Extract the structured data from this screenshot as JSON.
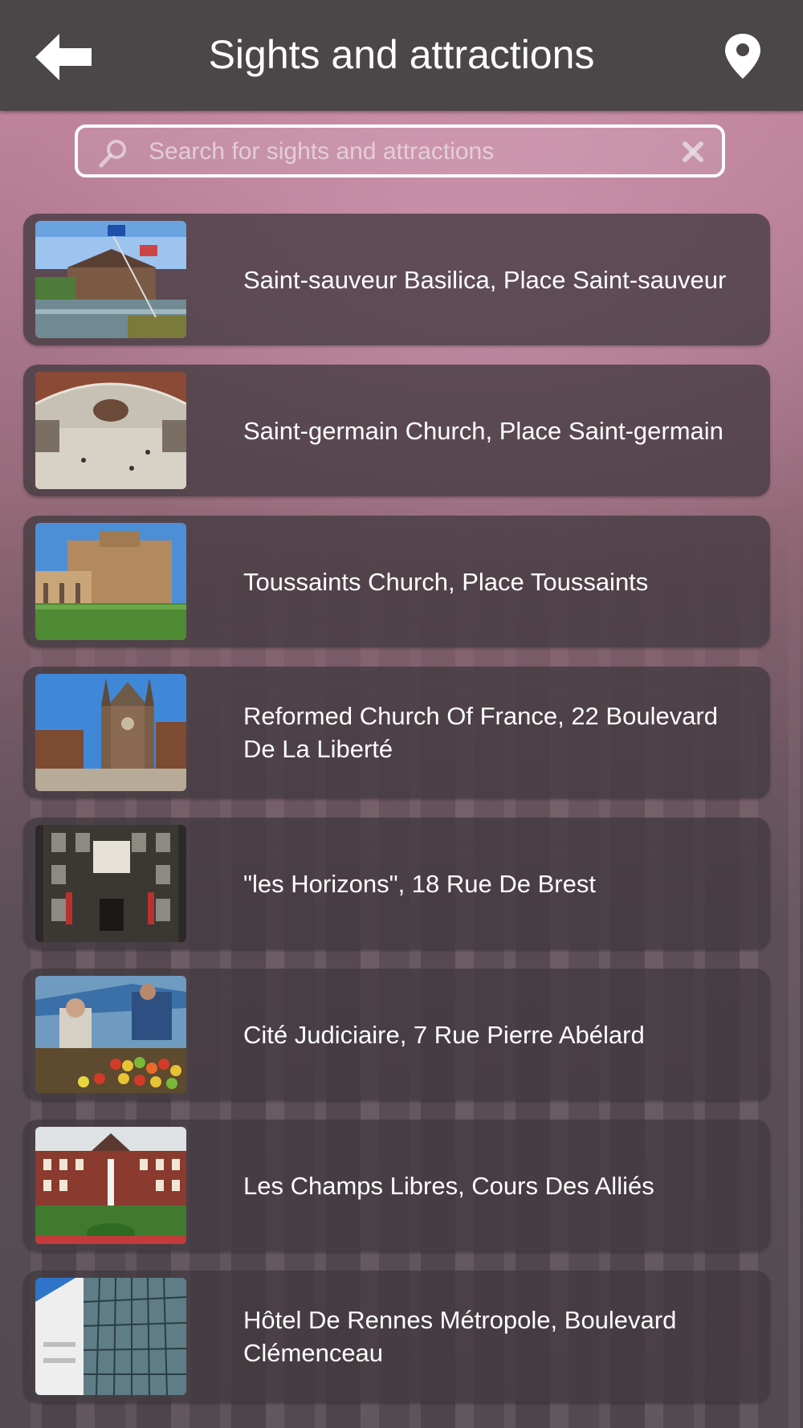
{
  "header": {
    "title": "Sights and attractions",
    "back_icon": "arrow-left-icon",
    "map_icon": "map-pin-icon",
    "bar_color": "#4b4748"
  },
  "search": {
    "placeholder": "Search for sights and attractions",
    "value": "",
    "search_icon": "magnifier-icon",
    "clear_icon": "close-icon"
  },
  "list": {
    "items": [
      {
        "label": "Saint-sauveur Basilica, Place Saint-sauveur",
        "thumbnail": "parliament-pond-flags"
      },
      {
        "label": "Saint-germain Church, Place Saint-germain",
        "thumbnail": "panorama-dome-hall"
      },
      {
        "label": "Toussaints Church, Place Toussaints",
        "thumbnail": "brick-building-garden"
      },
      {
        "label": "Reformed Church Of France, 22 Boulevard De La Liberté",
        "thumbnail": "gothic-hall-towers"
      },
      {
        "label": "\"les Horizons\", 18 Rue De Brest",
        "thumbnail": "museum-facade"
      },
      {
        "label": "Cité Judiciaire, 7 Rue Pierre Abélard",
        "thumbnail": "fruit-market"
      },
      {
        "label": "Les Champs Libres, Cours Des Alliés",
        "thumbnail": "palace-gardens"
      },
      {
        "label": "Hôtel De Rennes Métropole, Boulevard Clémenceau",
        "thumbnail": "glass-tower"
      }
    ]
  }
}
